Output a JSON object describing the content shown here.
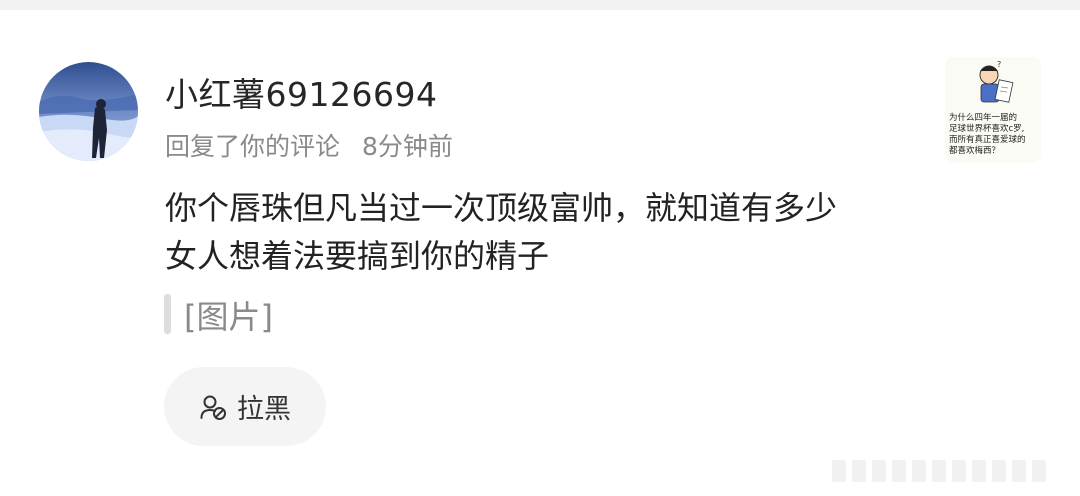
{
  "comment_card": {
    "user": {
      "name": "小红薯69126694"
    },
    "meta": {
      "action": "回复了你的评论",
      "time": "8分钟前"
    },
    "content": {
      "line1": "你个唇珠但凡当过一次顶级富帅，就知道有多少",
      "line2": "女人想着法要搞到你的精子"
    },
    "attachment": {
      "label": "[图片]"
    },
    "actions": {
      "block_label": "拉黑",
      "block_icon": "user-block-icon"
    },
    "thumbnail": {
      "caption_line1": "为什么四年一届的",
      "caption_line2": "足球世界杯喜欢c罗,",
      "caption_line3": "而所有真正喜爱球的",
      "caption_line4": "都喜欢梅西？"
    }
  },
  "colors": {
    "text_primary": "#262626",
    "text_secondary": "#8a8a8a",
    "button_bg": "#f4f4f4"
  }
}
